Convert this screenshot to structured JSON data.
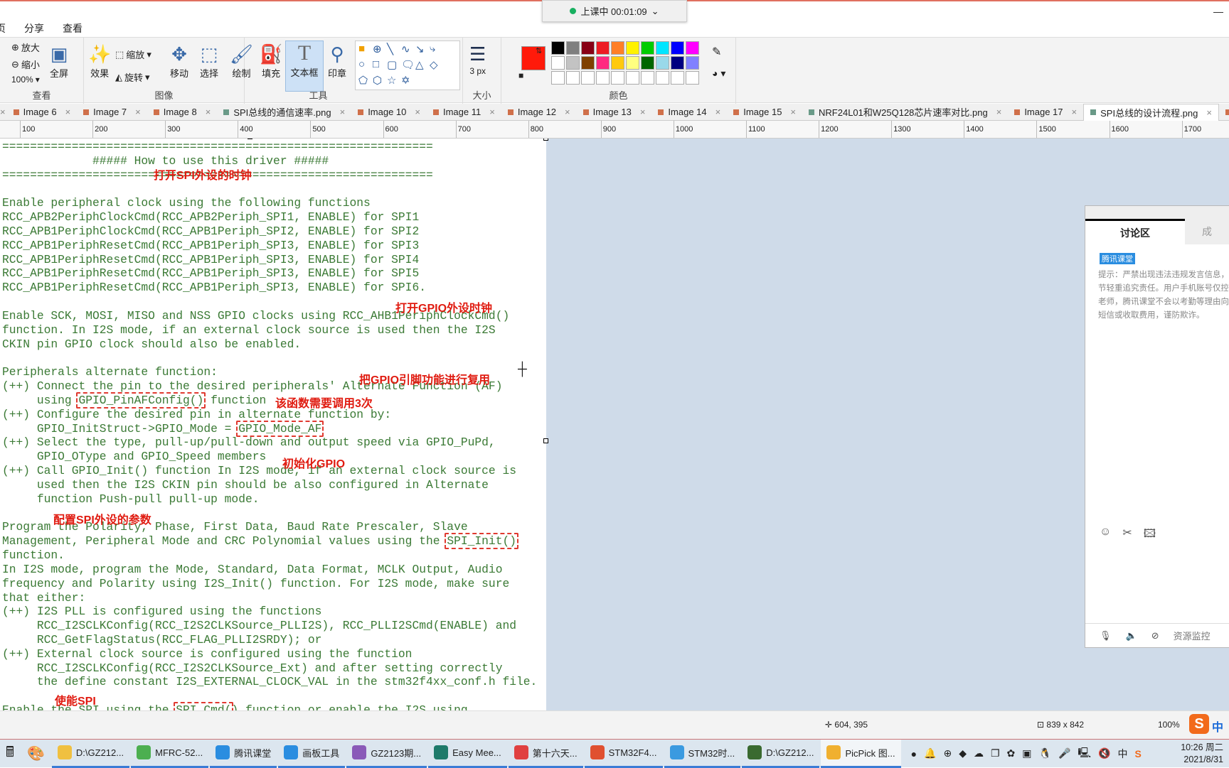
{
  "session": {
    "label": "上课中 00:01:09",
    "status_color": "#18b060"
  },
  "menu": [
    "页",
    "分享",
    "查看"
  ],
  "ribbon": {
    "view": {
      "zoom_in": "放大",
      "zoom_out": "缩小",
      "zoom_level": "100%",
      "fullscreen": "全屏",
      "label": "查看"
    },
    "image": {
      "effects": "效果",
      "resize": "缩放",
      "rotate": "旋转",
      "label": "图像"
    },
    "tools": {
      "move": "移动",
      "select": "选择",
      "draw": "绘制",
      "fill": "填充",
      "textbox": "文本框",
      "stamp": "印章",
      "label": "工具"
    },
    "shapes": [
      "■",
      "⊕",
      "╲",
      "∿",
      "↘",
      "⤷",
      "○",
      "□",
      "▢",
      "🗨",
      "△",
      "◇",
      "⬠",
      "⬡",
      "☆",
      "✡"
    ],
    "size": {
      "value": "3 px",
      "label": "大小"
    },
    "color": {
      "primary": "#ff1a0a",
      "secondary": "#ffffff",
      "label": "颜色",
      "palette": [
        "#000000",
        "#7f7f7f",
        "#880015",
        "#ed1c24",
        "#ff7f27",
        "#fff200",
        "#00cc00",
        "#00e5ff",
        "#0000ff",
        "#ff00ff",
        "#ffffff",
        "#c3c3c3",
        "#7f4000",
        "#ff2a80",
        "#ffc90e",
        "#ffff80",
        "#006600",
        "#99d9ea",
        "#000080",
        "#8080ff",
        "#ffffff",
        "#ffffff",
        "#ffffff",
        "#ffffff",
        "#ffffff",
        "#ffffff",
        "#ffffff",
        "#ffffff",
        "#ffffff",
        "#ffffff"
      ]
    }
  },
  "image_tabs": [
    {
      "label": "Image 6",
      "color": "#d0704a"
    },
    {
      "label": "Image 7",
      "color": "#d0704a"
    },
    {
      "label": "Image 8",
      "color": "#d0704a"
    },
    {
      "label": "SPI总线的通信速率.png",
      "color": "#6a9a88"
    },
    {
      "label": "Image 10",
      "color": "#d0704a"
    },
    {
      "label": "Image 11",
      "color": "#d0704a"
    },
    {
      "label": "Image 12",
      "color": "#d0704a"
    },
    {
      "label": "Image 13",
      "color": "#d0704a"
    },
    {
      "label": "Image 14",
      "color": "#d0704a"
    },
    {
      "label": "Image 15",
      "color": "#d0704a"
    },
    {
      "label": "NRF24L01和W25Q128芯片速率对比.png",
      "color": "#6a9a88"
    },
    {
      "label": "Image 17",
      "color": "#d0704a"
    },
    {
      "label": "SPI总线的设计流程.png",
      "color": "#6a9a88",
      "active": true
    },
    {
      "label": "Image 19",
      "color": "#d0704a"
    }
  ],
  "ruler": [
    "100",
    "200",
    "300",
    "400",
    "500",
    "600",
    "700",
    "800",
    "900",
    "1000",
    "1100",
    "1200",
    "1300",
    "1400",
    "1500",
    "1600",
    "1700"
  ],
  "doc": {
    "lines": [
      {
        "t": "=============================================================="
      },
      {
        "t": "             ##### How to use this driver #####"
      },
      {
        "t": "=============================================================="
      },
      {
        "t": ""
      },
      {
        "t": "Enable peripheral clock using the following functions"
      },
      {
        "t": "RCC_APB2PeriphClockCmd(RCC_APB2Periph_SPI1, ENABLE) for SPI1"
      },
      {
        "t": "RCC_APB1PeriphClockCmd(RCC_APB1Periph_SPI2, ENABLE) for SPI2"
      },
      {
        "t": "RCC_APB1PeriphResetCmd(RCC_APB1Periph_SPI3, ENABLE) for SPI3"
      },
      {
        "t": "RCC_APB1PeriphResetCmd(RCC_APB1Periph_SPI3, ENABLE) for SPI4"
      },
      {
        "t": "RCC_APB1PeriphResetCmd(RCC_APB1Periph_SPI3, ENABLE) for SPI5"
      },
      {
        "t": "RCC_APB1PeriphResetCmd(RCC_APB1Periph_SPI3, ENABLE) for SPI6."
      },
      {
        "t": ""
      },
      {
        "t": "Enable SCK, MOSI, MISO and NSS GPIO clocks using RCC_AHB1PeriphClockCmd()"
      },
      {
        "t": "function. In I2S mode, if an external clock source is used then the I2S"
      },
      {
        "t": "CKIN pin GPIO clock should also be enabled."
      },
      {
        "t": ""
      },
      {
        "t": "Peripherals alternate function:"
      },
      {
        "t": "(++) Connect the pin to the desired peripherals' Alternate Function (AF)"
      },
      {
        "t": "     using ",
        "box": "GPIO_PinAFConfig()",
        "post": " function"
      },
      {
        "t": "(++) Configure the desired pin in alternate function by:"
      },
      {
        "t": "     GPIO_InitStruct->GPIO_Mode = ",
        "box": "GPIO_Mode_AF",
        "post": ""
      },
      {
        "t": "(++) Select the type, pull-up/pull-down and output speed via GPIO_PuPd,"
      },
      {
        "t": "     GPIO_OType and GPIO_Speed members"
      },
      {
        "t": "(++) Call GPIO_Init() function In I2S mode, if an external clock source is"
      },
      {
        "t": "     used then the I2S CKIN pin should be also configured in Alternate"
      },
      {
        "t": "     function Push-pull pull-up mode."
      },
      {
        "t": ""
      },
      {
        "t": "Program the Polarity, Phase, First Data, Baud Rate Prescaler, Slave"
      },
      {
        "t": "Management, Peripheral Mode and CRC Polynomial values using the ",
        "box": "SPI_Init()",
        "post": ""
      },
      {
        "t": "function."
      },
      {
        "t": "In I2S mode, program the Mode, Standard, Data Format, MCLK Output, Audio"
      },
      {
        "t": "frequency and Polarity using I2S_Init() function. For I2S mode, make sure"
      },
      {
        "t": "that either:"
      },
      {
        "t": "(++) I2S PLL is configured using the functions"
      },
      {
        "t": "     RCC_I2SCLKConfig(RCC_I2S2CLKSource_PLLI2S), RCC_PLLI2SCmd(ENABLE) and"
      },
      {
        "t": "     RCC_GetFlagStatus(RCC_FLAG_PLLI2SRDY); or"
      },
      {
        "t": "(++) External clock source is configured using the function"
      },
      {
        "t": "     RCC_I2SCLKConfig(RCC_I2S2CLKSource_Ext) and after setting correctly"
      },
      {
        "t": "     the define constant I2S_EXTERNAL_CLOCK_VAL in the stm32f4xx_conf.h file."
      },
      {
        "t": ""
      },
      {
        "t": "Enable the SPI using the ",
        "box": "SPI_Cmd(",
        "post": ") function or enable the I2S using"
      }
    ],
    "annotations": {
      "spi_clock": "打开SPI外设的时钟",
      "gpio_clock": "打开GPIO外设时钟",
      "gpio_af": "把GPIO引脚功能进行复用",
      "call_3": "该函数需要调用3次",
      "init_gpio": "初始化GPIO",
      "config_spi": "配置SPI外设的参数",
      "enable_spi": "使能SPI"
    },
    "annotation_color": "#e01b10"
  },
  "chat": {
    "tab_active": "讨论区",
    "tab_other": "成",
    "badge": "腾讯课堂",
    "notice": [
      "提示：严禁出现违法违规发言信息，",
      "节轻重追究责任。用户手机账号仅控",
      "老师，腾讯课堂不会以考勤等理由向",
      "短信或收取费用，谨防欺诈。"
    ],
    "resource": "资源监控"
  },
  "status": {
    "cursor": "604, 395",
    "image_size": "839 x 842",
    "zoom": "100%",
    "ime": "中"
  },
  "taskbar": {
    "items": [
      {
        "label": "D:\\GZ212...",
        "color": "#f0c040"
      },
      {
        "label": "MFRC-52...",
        "color": "#4caf50"
      },
      {
        "label": "腾讯课堂",
        "color": "#2a8de0"
      },
      {
        "label": "画板工具",
        "color": "#2a8de0"
      },
      {
        "label": "GZ2123期...",
        "color": "#8a5ab8"
      },
      {
        "label": "Easy Mee...",
        "color": "#1e7a6a"
      },
      {
        "label": "第十六天...",
        "color": "#e04040"
      },
      {
        "label": "STM32F4...",
        "color": "#e05030"
      },
      {
        "label": "STM32时...",
        "color": "#3a9ae0"
      },
      {
        "label": "D:\\GZ212...",
        "color": "#3a6a30"
      },
      {
        "label": "PicPick 图...",
        "color": "#f0b030",
        "active": true
      }
    ],
    "time": "10:26 周二",
    "date": "2021/8/31"
  }
}
